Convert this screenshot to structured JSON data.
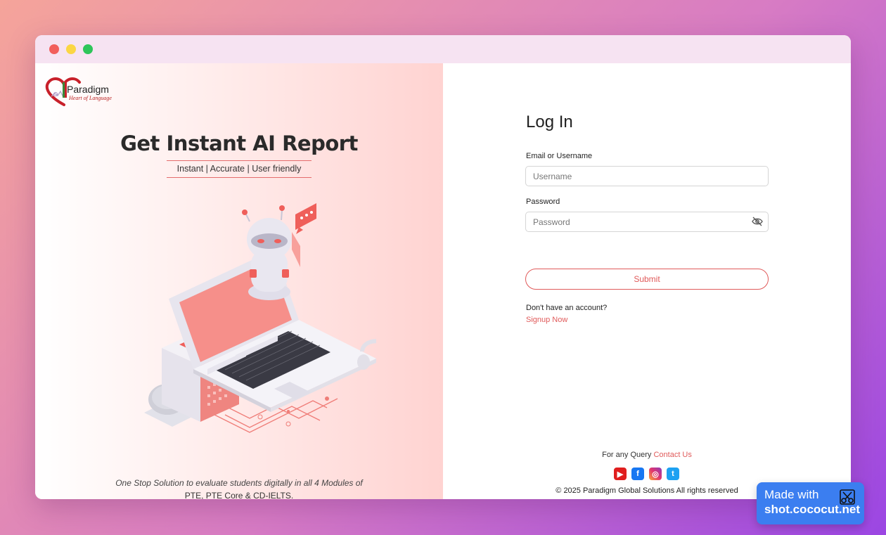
{
  "window": {
    "controls": [
      "close",
      "minimize",
      "maximize"
    ]
  },
  "brand": {
    "name": "Paradigm",
    "tagline": "Heart of Language"
  },
  "hero": {
    "title": "Get Instant AI Report",
    "subtitle": "Instant | Accurate | User friendly",
    "illustration_label": "AI",
    "tagline_line1": "One Stop Solution to evaluate students digitally in all 4 Modules of",
    "tagline_line2": "PTE, PTE Core & CD-IELTS."
  },
  "login": {
    "title": "Log In",
    "email_label": "Email or Username",
    "email_placeholder": "Username",
    "email_value": "",
    "password_label": "Password",
    "password_placeholder": "Password",
    "password_value": "",
    "submit_label": "Submit",
    "no_account_text": "Don't have an account?",
    "signup_link": "Signup Now"
  },
  "footer": {
    "query_text": "For any Query",
    "contact_link": "Contact Us",
    "socials": [
      "youtube-icon",
      "facebook-icon",
      "instagram-icon",
      "twitter-icon"
    ],
    "copyright": "© 2025 Paradigm Global Solutions All rights reserved"
  },
  "badge": {
    "line1": "Made with",
    "line2": "shot.cococut.net"
  },
  "colors": {
    "accent": "#e05a5a",
    "left_panel_pink": "#ffd3d1",
    "window_titlebar": "#f6e3f2",
    "badge_blue": "#3b7ef0"
  }
}
